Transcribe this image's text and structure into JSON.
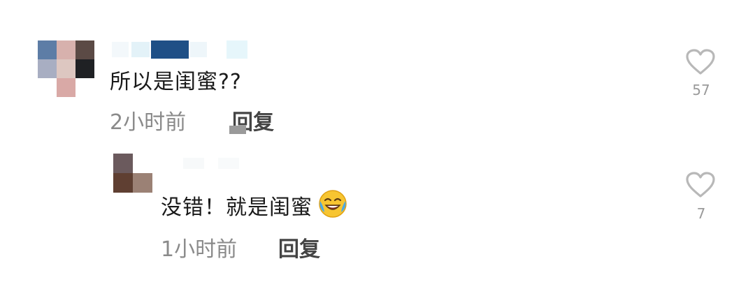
{
  "comments": [
    {
      "author_name": "",
      "text": "所以是闺蜜??",
      "time": "2小时前",
      "reply_label": "回复",
      "likes": "57"
    }
  ],
  "replies": [
    {
      "author_name": "",
      "text": "没错！就是闺蜜",
      "emoji": "crying-laughing-emoji",
      "time": "1小时前",
      "reply_label": "回复",
      "likes": "7"
    }
  ],
  "colors": {
    "text": "#1a1a1a",
    "meta": "#8a8a8a",
    "heart_outline": "#b8b8b8"
  }
}
